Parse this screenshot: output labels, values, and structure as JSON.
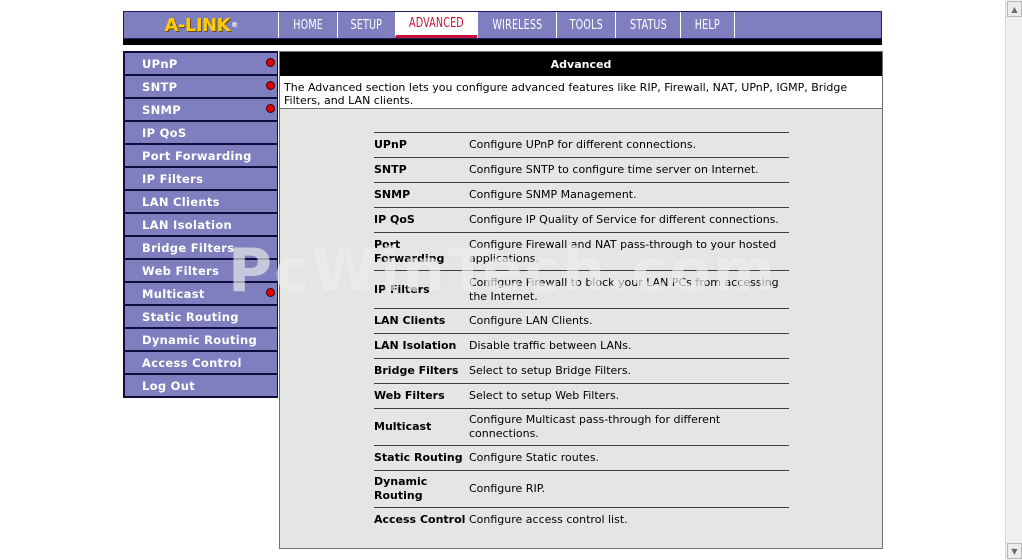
{
  "brand": {
    "logo_text": "A-LINK",
    "logo_mark": "®"
  },
  "nav": {
    "tabs": [
      {
        "label": "HOME"
      },
      {
        "label": "SETUP"
      },
      {
        "label": "ADVANCED",
        "active": true
      },
      {
        "label": "WIRELESS"
      },
      {
        "label": "TOOLS"
      },
      {
        "label": "STATUS"
      },
      {
        "label": "HELP"
      }
    ]
  },
  "sidebar": {
    "items": [
      {
        "label": "UPnP",
        "flag": "red-dot-icon"
      },
      {
        "label": "SNTP",
        "flag": "red-dot-icon"
      },
      {
        "label": "SNMP",
        "flag": "red-dot-icon"
      },
      {
        "label": "IP QoS"
      },
      {
        "label": "Port Forwarding"
      },
      {
        "label": "IP Filters"
      },
      {
        "label": "LAN Clients"
      },
      {
        "label": "LAN Isolation"
      },
      {
        "label": "Bridge Filters"
      },
      {
        "label": "Web Filters"
      },
      {
        "label": "Multicast",
        "flag": "red-dot-icon"
      },
      {
        "label": "Static Routing"
      },
      {
        "label": "Dynamic Routing"
      },
      {
        "label": "Access Control"
      },
      {
        "label": "Log Out"
      }
    ]
  },
  "main": {
    "title": "Advanced",
    "intro": "The Advanced section lets you configure advanced features like RIP, Firewall, NAT, UPnP, IGMP, Bridge Filters, and LAN clients.",
    "rows": [
      {
        "name": "UPnP",
        "desc": "Configure UPnP for different connections."
      },
      {
        "name": "SNTP",
        "desc": "Configure SNTP to configure time server on Internet."
      },
      {
        "name": "SNMP",
        "desc": "Configure SNMP Management."
      },
      {
        "name": "IP QoS",
        "desc": "Configure IP Quality of Service for different connections."
      },
      {
        "name": "Port Forwarding",
        "desc": "Configure Firewall and NAT pass-through to your hosted applications."
      },
      {
        "name": "IP Filters",
        "desc": "Configure Firewall to block your LAN PCs from accessing the Internet."
      },
      {
        "name": "LAN Clients",
        "desc": "Configure LAN Clients."
      },
      {
        "name": "LAN Isolation",
        "desc": "Disable traffic between LANs."
      },
      {
        "name": "Bridge Filters",
        "desc": "Select to setup Bridge Filters."
      },
      {
        "name": "Web Filters",
        "desc": "Select to setup Web Filters."
      },
      {
        "name": "Multicast",
        "desc": "Configure Multicast pass-through for different connections."
      },
      {
        "name": "Static Routing",
        "desc": "Configure Static routes."
      },
      {
        "name": "Dynamic Routing",
        "desc": "Configure RIP."
      },
      {
        "name": "Access Control",
        "desc": "Configure access control list."
      }
    ]
  },
  "watermark": "PcWinTech.com",
  "colors": {
    "nav_bg": "#7f7fbf",
    "active_tab_text": "#c8103a",
    "logo": "#ffcc00",
    "sidebar_bg": "#7f7fbf",
    "content_bg": "#e5e5e5",
    "status_dot": "#e00000"
  }
}
